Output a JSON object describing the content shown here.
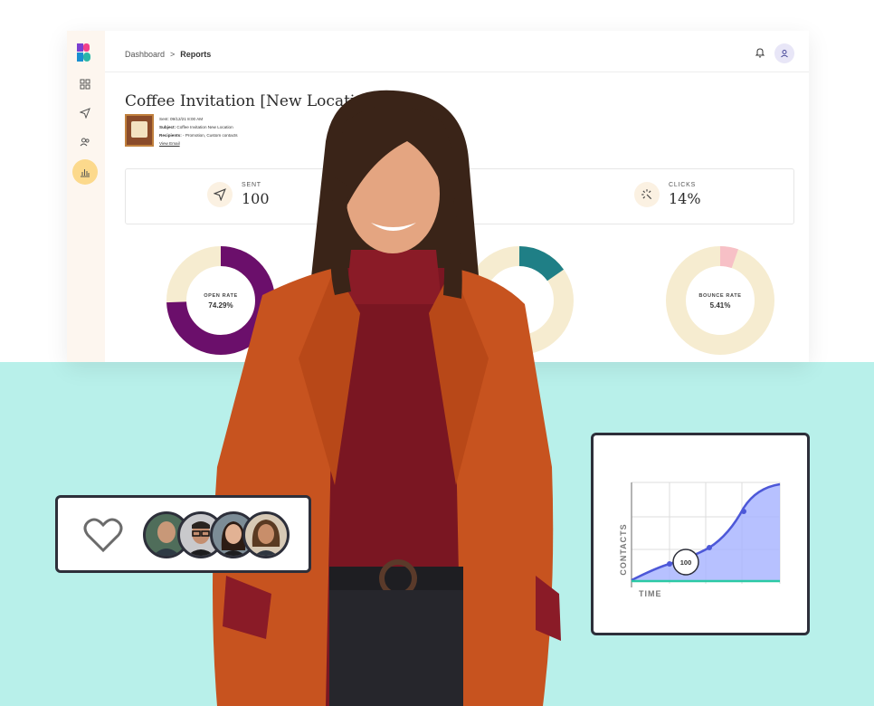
{
  "breadcrumb": {
    "home": "Dashboard",
    "separator": ">",
    "current": "Reports"
  },
  "campaign": {
    "title": "Coffee Invitation [New Location]",
    "sent_line": "Sent: 09/12/21 8:00 AM",
    "subject_label": "Subject:",
    "subject_value": "Coffee Invitation New Location",
    "recipients_label": "Recipients:",
    "recipients_value": "Promotion, Custom contacts",
    "view_email": "View Email"
  },
  "stats": [
    {
      "label": "SENT",
      "value": "100",
      "icon": "send-icon"
    },
    {
      "label": "CLICKS",
      "value": "14%",
      "icon": "cursor-click-icon"
    }
  ],
  "donuts": [
    {
      "label": "OPEN RATE",
      "value": "74.29%",
      "fraction": 0.7429,
      "color": "#6b0f6b"
    },
    {
      "label": "BOUNCE RATE",
      "value": "5.41%",
      "fraction": 0.0541,
      "color": "#f7c0c6"
    }
  ],
  "colors": {
    "accent": "#fcd98c",
    "sidebar": "#fdf6ef",
    "teal_bg": "#b8f0ea",
    "donut_track": "#f6ecd0",
    "card_border": "#2d2f3a"
  },
  "nav_icons": [
    "dashboard-grid-icon",
    "send-icon",
    "contacts-icon",
    "reports-chart-icon"
  ],
  "likes_card": {
    "icon": "heart-icon",
    "avatar_count": 4
  },
  "contacts_chart": {
    "ylabel": "CONTACTS",
    "xlabel": "TIME",
    "marker_label": "100"
  }
}
